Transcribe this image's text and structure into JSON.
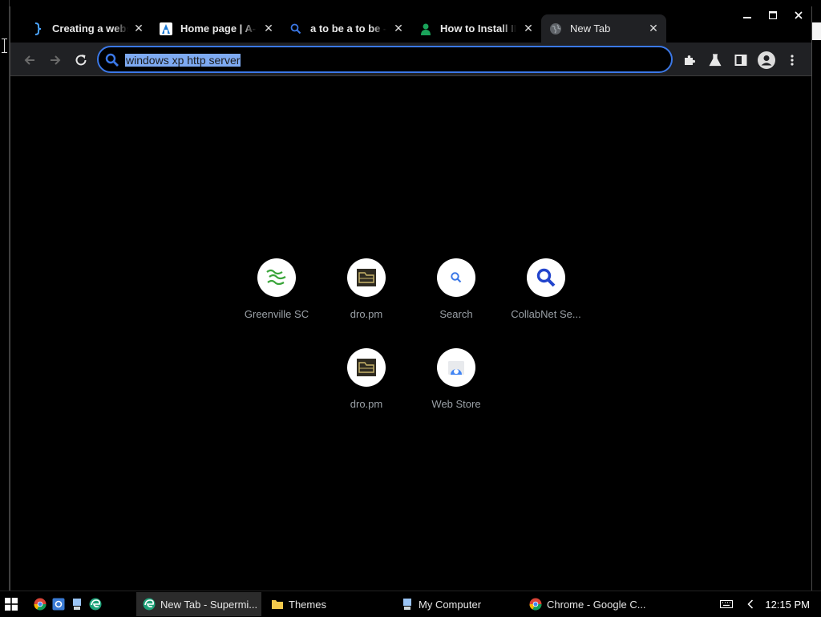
{
  "browser": {
    "tabs": [
      {
        "title": "Creating a websei",
        "favicon": "bracket-icon"
      },
      {
        "title": "Home page | A-te",
        "favicon": "a-logo-icon"
      },
      {
        "title": "a to be a to be - S",
        "favicon": "search-icon"
      },
      {
        "title": "How to Install IIS",
        "favicon": "person-icon"
      },
      {
        "title": "New Tab",
        "favicon": "globe-icon"
      }
    ],
    "omnibox": {
      "value": "windows xp http server"
    }
  },
  "shortcuts": [
    {
      "label": "Greenville SC"
    },
    {
      "label": "dro.pm"
    },
    {
      "label": "Search"
    },
    {
      "label": "CollabNet Se..."
    },
    {
      "label": "dro.pm"
    },
    {
      "label": "Web Store"
    }
  ],
  "taskbar": {
    "tasks": [
      {
        "label": "New Tab - Supermi..."
      },
      {
        "label": "Themes"
      },
      {
        "label": "My Computer"
      },
      {
        "label": "Chrome - Google C..."
      }
    ],
    "clock": "12:15 PM"
  },
  "colors": {
    "accent": "#3b78e7",
    "toolbar": "#202124",
    "label": "#9aa0a6"
  }
}
